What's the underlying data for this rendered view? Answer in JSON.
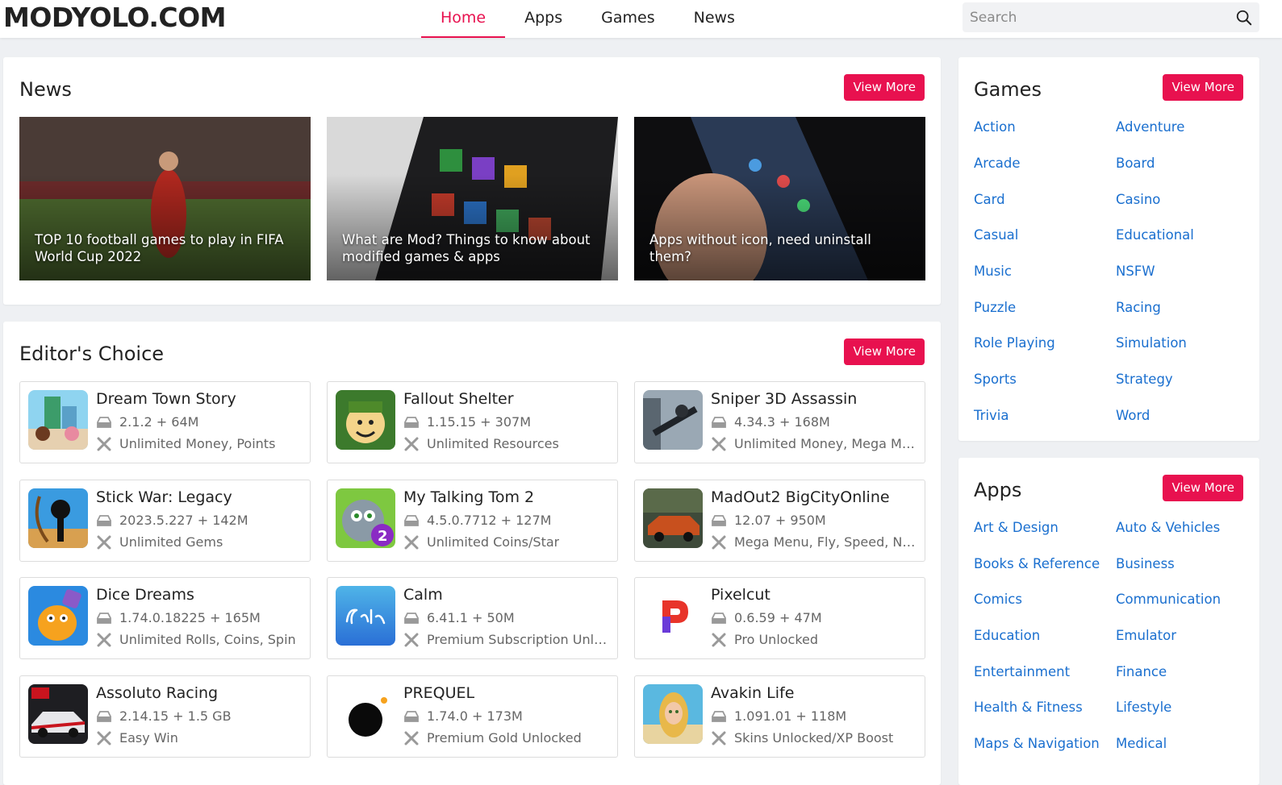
{
  "header": {
    "logo": "MODYOLO.COM",
    "nav": [
      "Home",
      "Apps",
      "Games",
      "News"
    ],
    "active_nav": "Home",
    "search_placeholder": "Search"
  },
  "news": {
    "title": "News",
    "view_more": "View More",
    "items": [
      {
        "caption": "TOP 10 football games to play in FIFA World Cup 2022"
      },
      {
        "caption": "What are Mod? Things to know about modified games & apps"
      },
      {
        "caption": "Apps without icon, need uninstall them?"
      }
    ]
  },
  "editors_choice": {
    "title": "Editor's Choice",
    "view_more": "View More",
    "apps": [
      {
        "name": "Dream Town Story",
        "version": "2.1.2 + 64M",
        "mod": "Unlimited Money, Points"
      },
      {
        "name": "Fallout Shelter",
        "version": "1.15.15 + 307M",
        "mod": "Unlimited Resources"
      },
      {
        "name": "Sniper 3D Assassin",
        "version": "4.34.3 + 168M",
        "mod": "Unlimited Money, Mega Me..."
      },
      {
        "name": "Stick War: Legacy",
        "version": "2023.5.227 + 142M",
        "mod": "Unlimited Gems"
      },
      {
        "name": "My Talking Tom 2",
        "version": "4.5.0.7712 + 127M",
        "mod": "Unlimited Coins/Star"
      },
      {
        "name": "MadOut2 BigCityOnline",
        "version": "12.07 + 950M",
        "mod": "Mega Menu, Fly, Speed, No ..."
      },
      {
        "name": "Dice Dreams",
        "version": "1.74.0.18225 + 165M",
        "mod": "Unlimited Rolls, Coins, Spin"
      },
      {
        "name": "Calm",
        "version": "6.41.1 + 50M",
        "mod": "Premium Subscription Unloc..."
      },
      {
        "name": "Pixelcut",
        "version": "0.6.59 + 47M",
        "mod": "Pro Unlocked"
      },
      {
        "name": "Assoluto Racing",
        "version": "2.14.15 + 1.5 GB",
        "mod": "Easy Win"
      },
      {
        "name": "PREQUEL",
        "version": "1.74.0 + 173M",
        "mod": "Premium Gold Unlocked"
      },
      {
        "name": "Avakin Life",
        "version": "1.091.01 + 118M",
        "mod": "Skins Unlocked/XP Boost"
      }
    ]
  },
  "games": {
    "title": "Games",
    "view_more": "View More",
    "categories": [
      "Action",
      "Adventure",
      "Arcade",
      "Board",
      "Card",
      "Casino",
      "Casual",
      "Educational",
      "Music",
      "NSFW",
      "Puzzle",
      "Racing",
      "Role Playing",
      "Simulation",
      "Sports",
      "Strategy",
      "Trivia",
      "Word"
    ]
  },
  "apps": {
    "title": "Apps",
    "view_more": "View More",
    "categories": [
      "Art & Design",
      "Auto & Vehicles",
      "Books & Reference",
      "Business",
      "Comics",
      "Communication",
      "Education",
      "Emulator",
      "Entertainment",
      "Finance",
      "Health & Fitness",
      "Lifestyle",
      "Maps & Navigation",
      "Medical"
    ]
  },
  "colors": {
    "accent": "#e8114f",
    "link": "#1a6fcf",
    "background": "#eef0f3"
  },
  "icons": [
    "search-icon",
    "version-icon",
    "mod-tools-icon"
  ]
}
